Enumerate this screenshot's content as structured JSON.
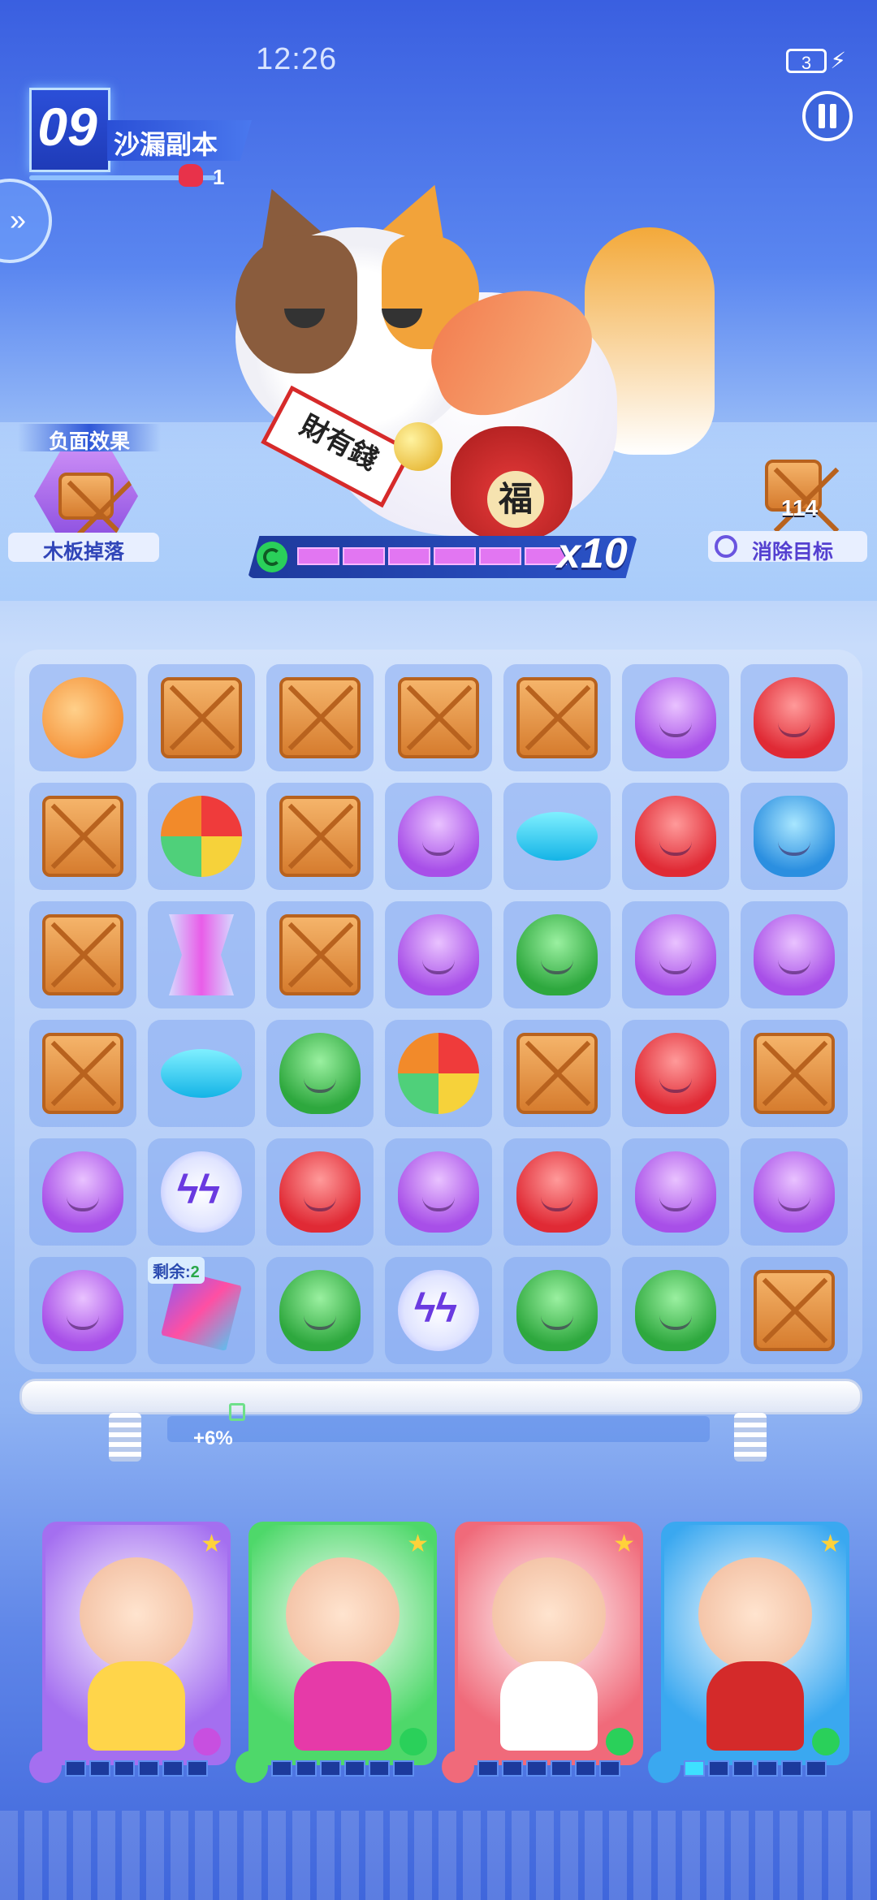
{
  "status_bar": {
    "time": "12:26",
    "battery": "3"
  },
  "level": {
    "number": "09",
    "name": "沙漏副本",
    "enemy_count": "1"
  },
  "boss": {
    "banner_text": "財有錢",
    "bag_text": "福",
    "multiplier": "x10",
    "health_segments_total": 6,
    "health_segments_filled": 6
  },
  "debuff": {
    "label": "负面效果",
    "name": "木板掉落",
    "icon": "crate-icon"
  },
  "goal": {
    "count": "114",
    "label": "消除目标",
    "icon": "crate-icon"
  },
  "board": {
    "rows": [
      [
        "bomb",
        "crate",
        "crate",
        "crate",
        "crate",
        "purple",
        "red"
      ],
      [
        "crate",
        "ball",
        "crate",
        "purple",
        "disc",
        "red",
        "blue"
      ],
      [
        "crate",
        "spool",
        "crate",
        "purple",
        "green",
        "purple",
        "purple"
      ],
      [
        "crate",
        "disc",
        "green",
        "ball",
        "crate",
        "red",
        "crate"
      ],
      [
        "purple",
        "zap",
        "red",
        "purple",
        "red",
        "purple",
        "purple"
      ],
      [
        "purple",
        "ribbon",
        "green",
        "zap",
        "green",
        "green",
        "crate"
      ]
    ],
    "remaining_tag": {
      "label": "剩余:",
      "value": "2"
    }
  },
  "energy": {
    "text": "+6%",
    "fraction": 0.06
  },
  "cards": [
    {
      "name": "purple-genie",
      "theme": "#a46ff0",
      "body": "#ffd54a",
      "energy_on": 0
    },
    {
      "name": "maid-girl",
      "theme": "#4ed86a",
      "body": "#e63aa8",
      "energy_on": 0
    },
    {
      "name": "redhair-girl",
      "theme": "#f06a7a",
      "body": "#ffffff",
      "energy_on": 0
    },
    {
      "name": "opera-warrior",
      "theme": "#3aa8f0",
      "body": "#d42a2a",
      "energy_on": 1
    }
  ],
  "colors": {
    "accent": "#2f58d8",
    "boss_bar": "#e276f2",
    "energy": "#3ee0ff"
  }
}
